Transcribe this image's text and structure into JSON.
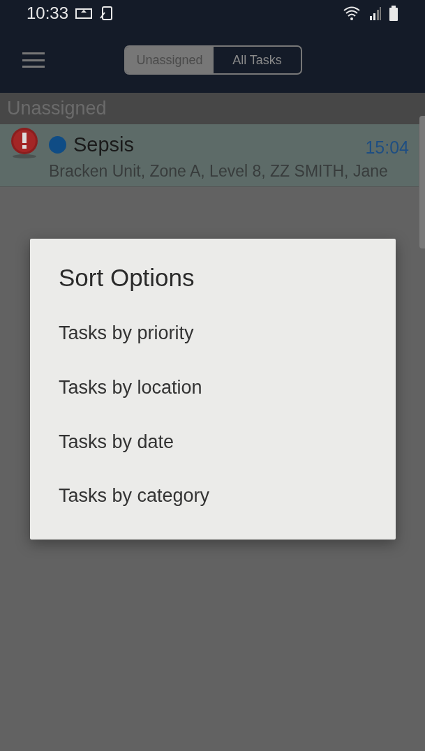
{
  "status_bar": {
    "time": "10:33"
  },
  "tabs": [
    {
      "label": "Unassigned",
      "selected": true
    },
    {
      "label": "All Tasks",
      "selected": false
    }
  ],
  "section": {
    "title": "Unassigned"
  },
  "tasks": [
    {
      "title": "Sepsis",
      "color": "#0f4c85",
      "urgent": true,
      "time": "15:04",
      "details": "Bracken Unit, Zone A, Level 8, ZZ SMITH, Jane"
    }
  ],
  "dialog": {
    "title": "Sort Options",
    "options": [
      "Tasks by priority",
      "Tasks by location",
      "Tasks by date",
      "Tasks by category"
    ]
  }
}
